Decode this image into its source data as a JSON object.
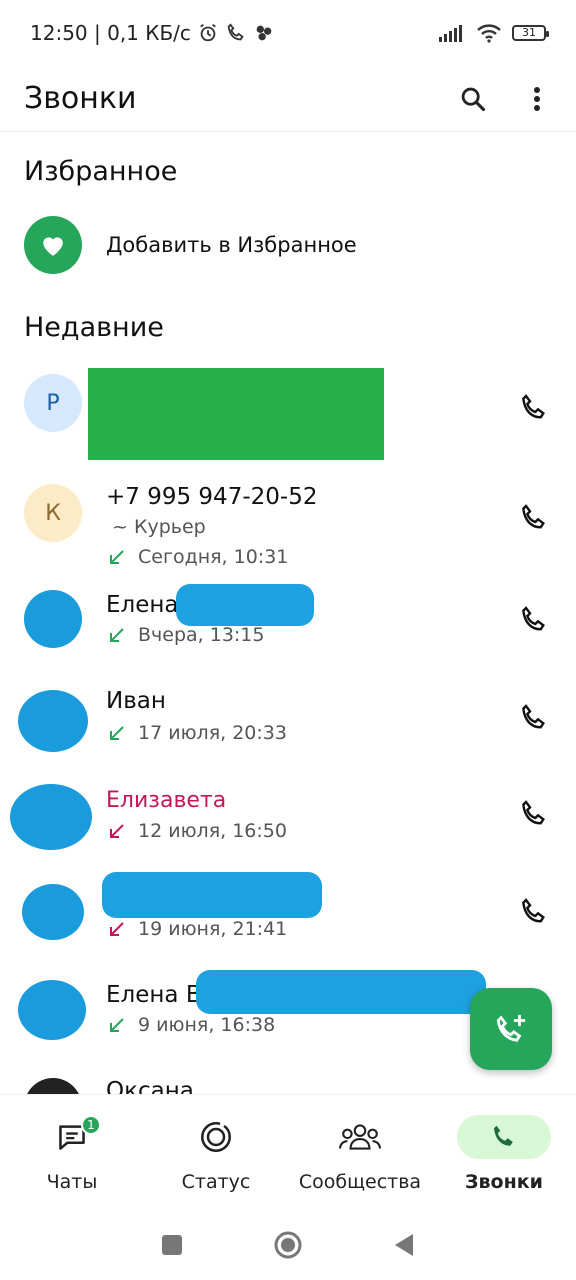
{
  "status_bar": {
    "time_info": "12:50 | 0,1 КБ/с",
    "battery": "31"
  },
  "app_bar": {
    "title": "Звонки",
    "search_icon": "search-icon",
    "menu_icon": "more-vert-icon"
  },
  "favorites": {
    "section_title": "Избранное",
    "add_label": "Добавить в Избранное"
  },
  "recent": {
    "section_title": "Недавние",
    "calls": [
      {
        "avatar_letter": "Р",
        "name": "",
        "direction": "",
        "when": ""
      },
      {
        "avatar_letter": "К",
        "name": "+7 995 947-20-52",
        "subname": "~ Курьер",
        "direction": "incoming",
        "when": "Сегодня, 10:31"
      },
      {
        "avatar_letter": "",
        "name": "Елена",
        "direction": "incoming",
        "when": "Вчера, 13:15"
      },
      {
        "avatar_letter": "",
        "name": "Иван",
        "direction": "incoming",
        "when": "17 июля, 20:33"
      },
      {
        "avatar_letter": "",
        "name": "Елизавета",
        "direction": "missed",
        "when": "12 июля, 16:50"
      },
      {
        "avatar_letter": "",
        "name": "",
        "direction": "missed",
        "when": "19 июня, 21:41"
      },
      {
        "avatar_letter": "",
        "name": "Елена В",
        "direction": "incoming",
        "when": "9 июня, 16:38"
      },
      {
        "avatar_letter": "",
        "name": "Оксана",
        "direction": "",
        "when": ""
      }
    ]
  },
  "bottom_nav": {
    "items": [
      {
        "label": "Чаты",
        "badge": "1"
      },
      {
        "label": "Статус"
      },
      {
        "label": "Сообщества"
      },
      {
        "label": "Звонки"
      }
    ]
  },
  "colors": {
    "accent": "#25a65a",
    "missed": "#c2185b",
    "active_tab_bg": "#d8f7d4"
  }
}
